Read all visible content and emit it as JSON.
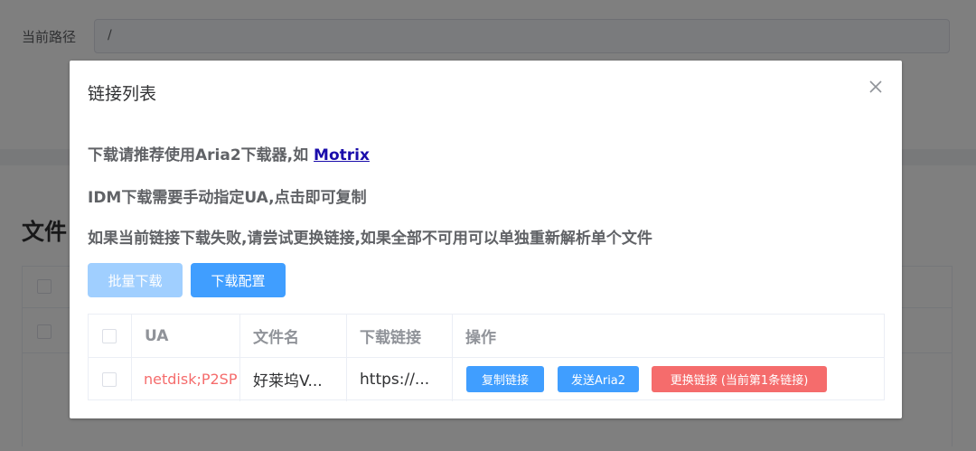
{
  "background": {
    "path_label": "当前路径",
    "path_value": "/",
    "files_title": "文件"
  },
  "dialog": {
    "title": "链接列表",
    "close_icon": "close-icon",
    "tip1_text": "下载请推荐使用Aria2下载器,如 ",
    "tip1_link": "Motrix",
    "tip2": "IDM下载需要手动指定UA,点击即可复制",
    "tip3": "如果当前链接下载失败,请尝试更换链接,如果全部不可用可以单独重新解析单个文件",
    "batch_download": "批量下载",
    "download_config": "下载配置",
    "table": {
      "headers": [
        "UA",
        "文件名",
        "下载链接",
        "操作"
      ],
      "rows": [
        {
          "ua": "netdisk;P2SP",
          "filename": "好莱坞V...",
          "link": "https://...",
          "actions": [
            "复制链接",
            "发送Aria2",
            "更换链接 (当前第1条链接)"
          ]
        }
      ]
    }
  },
  "colors": {
    "primary": "#409eff",
    "primary_disabled": "#a0cfff",
    "danger": "#f56c6c",
    "link": "#1a0dab"
  }
}
